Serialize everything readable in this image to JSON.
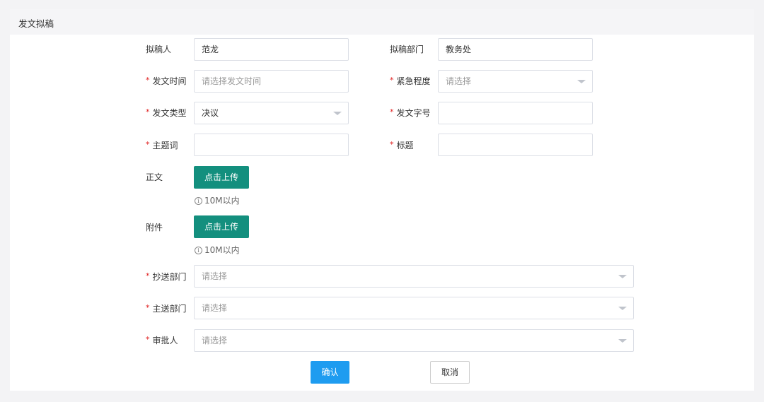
{
  "panel": {
    "title": "发文拟稿"
  },
  "form": {
    "drafter": {
      "label": "拟稿人",
      "value": "范龙"
    },
    "draft_dept": {
      "label": "拟稿部门",
      "value": "教务处"
    },
    "issue_time": {
      "label": "发文时间",
      "placeholder": "请选择发文时间",
      "required": true
    },
    "urgency": {
      "label": "紧急程度",
      "placeholder": "请选择",
      "required": true
    },
    "doc_type": {
      "label": "发文类型",
      "value": "决议",
      "required": true
    },
    "doc_number": {
      "label": "发文字号",
      "value": "",
      "required": true
    },
    "keywords": {
      "label": "主题词",
      "value": "",
      "required": true
    },
    "doc_title": {
      "label": "标题",
      "value": "",
      "required": true
    },
    "body_upload": {
      "label": "正文",
      "button": "点击上传",
      "hint": "10M以内"
    },
    "attachment_upload": {
      "label": "附件",
      "button": "点击上传",
      "hint": "10M以内"
    },
    "cc_dept": {
      "label": "抄送部门",
      "placeholder": "请选择",
      "required": true
    },
    "main_dept": {
      "label": "主送部门",
      "placeholder": "请选择",
      "required": true
    },
    "approver": {
      "label": "审批人",
      "placeholder": "请选择",
      "required": true
    }
  },
  "actions": {
    "confirm": "确认",
    "cancel": "取消"
  },
  "icons": {
    "info": "info-circle-icon",
    "dropdown": "caret-down-icon"
  },
  "colors": {
    "upload_button": "#138f7e",
    "confirm_button": "#1e9cf0",
    "required_mark": "#e02020"
  }
}
